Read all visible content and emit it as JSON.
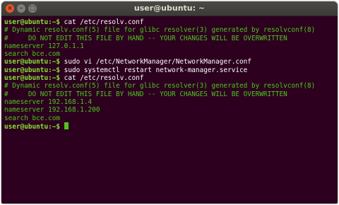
{
  "window": {
    "title": "user@ubuntu: ~"
  },
  "terminal": {
    "prompt": "user@ubuntu:~$",
    "lines": [
      {
        "type": "cmd",
        "text": " cat /etc/resolv.conf"
      },
      {
        "type": "out",
        "text": "# Dynamic resolv.conf(5) file for glibc resolver(3) generated by resolvconf(8)"
      },
      {
        "type": "out",
        "text": "#     DO NOT EDIT THIS FILE BY HAND -- YOUR CHANGES WILL BE OVERWRITTEN"
      },
      {
        "type": "out",
        "text": "nameserver 127.0.1.1"
      },
      {
        "type": "out",
        "text": "search bce.com"
      },
      {
        "type": "cmd",
        "text": " sudo vi /etc/NetworkManager/NetworkManager.conf"
      },
      {
        "type": "cmd",
        "text": " sudo systemctl restart network-manager.service"
      },
      {
        "type": "cmd",
        "text": " cat /etc/resolv.conf"
      },
      {
        "type": "out",
        "text": "# Dynamic resolv.conf(5) file for glibc resolver(3) generated by resolvconf(8)"
      },
      {
        "type": "out",
        "text": "#     DO NOT EDIT THIS FILE BY HAND -- YOUR CHANGES WILL BE OVERWRITTEN"
      },
      {
        "type": "out",
        "text": "nameserver 192.168.1.4"
      },
      {
        "type": "out",
        "text": "nameserver 192.168.1.200"
      },
      {
        "type": "out",
        "text": "search bce.com"
      },
      {
        "type": "cmd",
        "text": " "
      }
    ]
  },
  "colors": {
    "background": "#2c001e",
    "prompt": "#8ae234",
    "output": "#4fc41f",
    "command": "#ffffff"
  }
}
